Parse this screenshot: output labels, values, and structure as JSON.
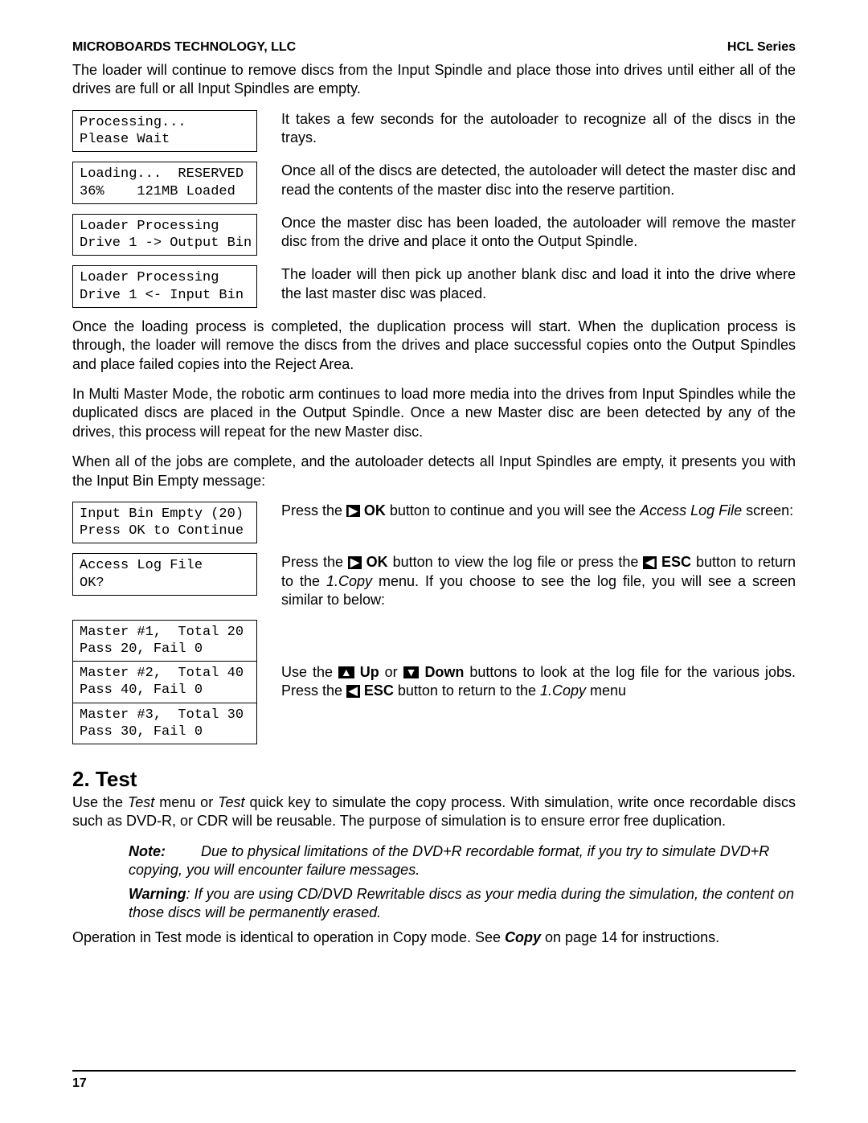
{
  "header": {
    "left": "MICROBOARDS TECHNOLOGY, LLC",
    "right": "HCL Series"
  },
  "intro": "The loader will continue to remove discs from the Input Spindle and place those into drives until either all of the drives are full or all Input Spindles are empty.",
  "block1": {
    "lcd": "Processing...\nPlease Wait",
    "desc": "It takes a few seconds for the autoloader to recognize all of the discs in the trays."
  },
  "block2": {
    "lcd": "Loading...  RESERVED\n36%    121MB Loaded",
    "desc": "Once all of the discs are detected, the autoloader will detect the master disc and read the contents of the master disc into the reserve partition."
  },
  "block3": {
    "lcd": "Loader Processing\nDrive 1 -> Output Bin",
    "desc": "Once the master disc has been loaded, the autoloader will remove the master disc from the drive and place it onto the Output Spindle."
  },
  "block4": {
    "lcd": "Loader Processing\nDrive 1 <- Input Bin",
    "desc": "The loader will then pick up another blank disc and load it into the drive where the last master disc was placed."
  },
  "para1": "Once the loading process is completed, the duplication process will start. When the duplication process is through, the loader will remove the discs from the drives and place successful copies onto the Output Spindles and place failed copies into the Reject Area.",
  "para2": "In Multi Master Mode, the robotic arm continues to load more media into the drives from Input Spindles while the duplicated discs are placed in the Output Spindle. Once a new Master disc are been detected by any of the drives, this process will repeat for the new Master disc.",
  "para3": "When all of the jobs are complete, and the autoloader detects all Input Spindles are empty, it presents you with the Input Bin Empty message:",
  "block5": {
    "lcd": "Input Bin Empty (20)\nPress OK to Continue",
    "desc_a": "Press the ",
    "ok_btn": "OK",
    "desc_b": " button to continue and you will see the ",
    "italic1": "Access Log File",
    "desc_c": " screen:"
  },
  "block6": {
    "lcd": "Access Log File\nOK?",
    "d1": "Press the ",
    "d2": " button to view the log file or press the ",
    "esc_btn": "ESC",
    "d3": " button to return to the ",
    "italic1": "1.Copy",
    "d4": " menu. If you choose to see the log file, you will see a screen similar to below:"
  },
  "block7": {
    "lcd1": "Master #1,  Total 20\nPass 20, Fail 0",
    "lcd2": "Master #2,  Total 40\nPass 40, Fail 0",
    "lcd3": "Master #3,  Total 30\nPass 30, Fail 0",
    "d1": "Use the ",
    "up_btn": "Up",
    "d2": " or ",
    "down_btn": "Down",
    "d3": " buttons to look at the log file for the various jobs. Press the ",
    "d4": " button to return to the ",
    "italic1": "1.Copy",
    "d5": " menu"
  },
  "section2": {
    "heading": "2. Test",
    "p1a": "Use the ",
    "p1i1": "Test",
    "p1b": " menu or ",
    "p1i2": "Test",
    "p1c": " quick key to simulate the copy process. With simulation, write once recordable discs such as DVD-R, or CDR will be reusable. The purpose of simulation is to ensure error free duplication.",
    "note_label": "Note:",
    "note_body": "Due to physical limitations of the DVD+R recordable format, if you try to simulate DVD+R copying, you will encounter failure messages.",
    "warn_label": "Warning",
    "warn_body": ": If you are using CD/DVD Rewritable discs as your media during the simulation, the content on those discs will be permanently erased.",
    "p2a": "Operation in Test mode is identical to operation in Copy mode. See ",
    "p2b": "Copy",
    "p2c": " on page 14 for instructions."
  },
  "page_number": "17"
}
